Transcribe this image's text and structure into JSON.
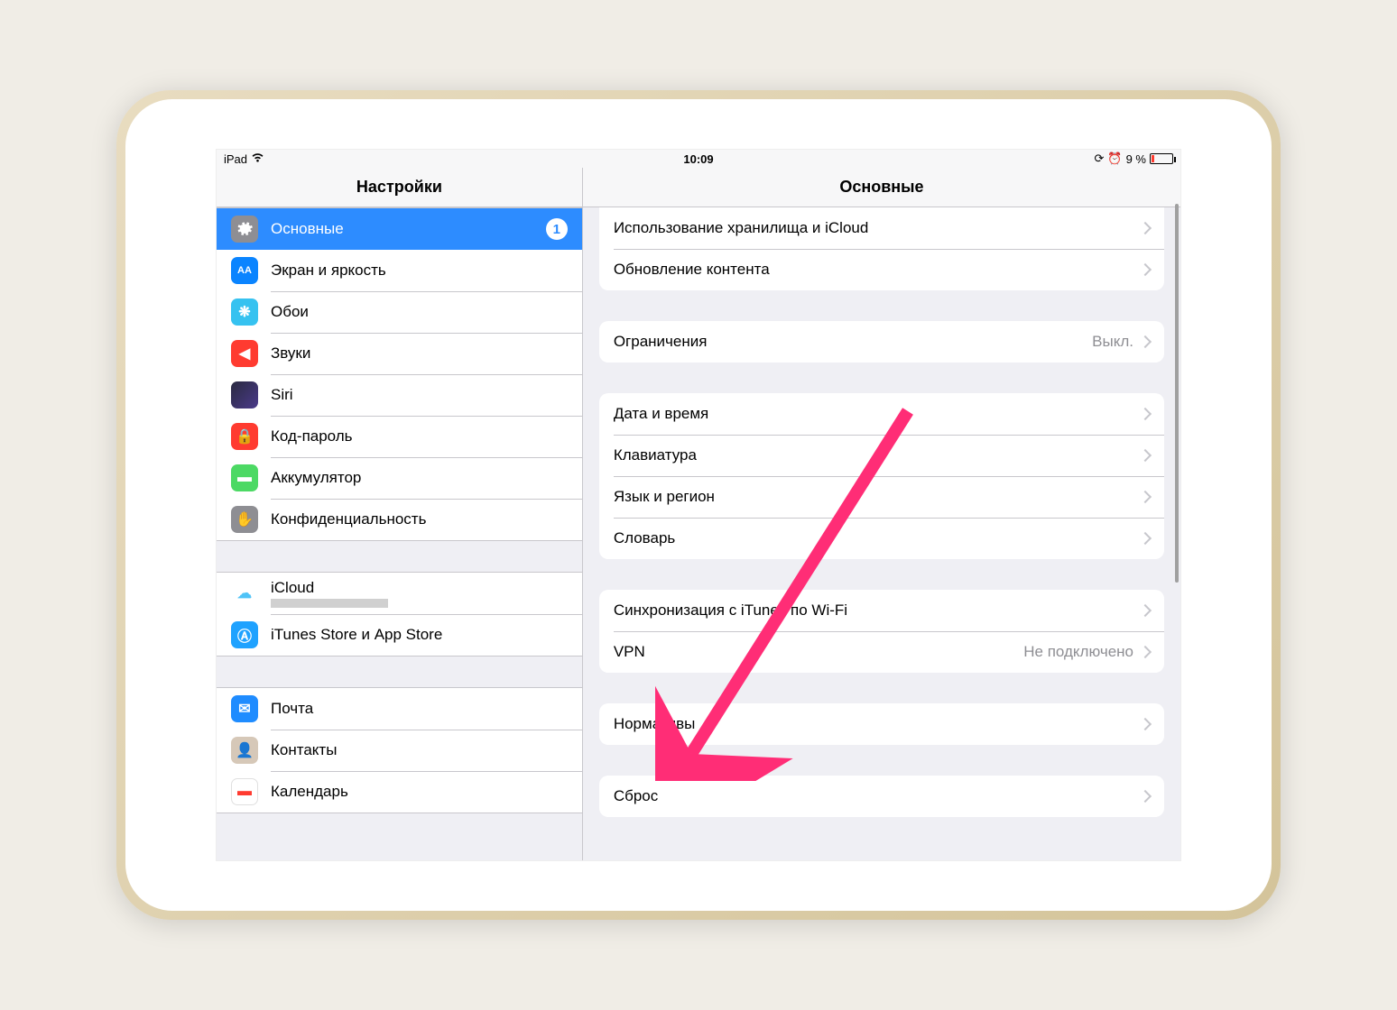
{
  "statusbar": {
    "device": "iPad",
    "time": "10:09",
    "battery_percent": "9 %"
  },
  "sidebar": {
    "title": "Настройки",
    "groups": [
      [
        {
          "id": "general",
          "label": "Основные",
          "icon": "gear-icon",
          "color": "ic-general",
          "selected": true,
          "badge": "1"
        },
        {
          "id": "display",
          "label": "Экран и яркость",
          "icon": "text-size-icon",
          "color": "ic-display",
          "glyph": "AA"
        },
        {
          "id": "wallpaper",
          "label": "Обои",
          "icon": "flower-icon",
          "color": "ic-wallpaper",
          "glyph": "❋"
        },
        {
          "id": "sounds",
          "label": "Звуки",
          "icon": "speaker-icon",
          "color": "ic-sounds",
          "glyph": "◀︎"
        },
        {
          "id": "siri",
          "label": "Siri",
          "icon": "siri-icon",
          "color": "ic-siri",
          "glyph": ""
        },
        {
          "id": "passcode",
          "label": "Код-пароль",
          "icon": "lock-icon",
          "color": "ic-passcode",
          "glyph": "🔒"
        },
        {
          "id": "battery",
          "label": "Аккумулятор",
          "icon": "battery-icon",
          "color": "ic-battery",
          "glyph": "▬"
        },
        {
          "id": "privacy",
          "label": "Конфиденциальность",
          "icon": "hand-icon",
          "color": "ic-privacy",
          "glyph": "✋"
        }
      ],
      [
        {
          "id": "icloud",
          "label": "iCloud",
          "icon": "cloud-icon",
          "color": "ic-icloud",
          "glyph": "☁︎",
          "glyph_color": "#4fc3f7",
          "has_sub": true
        },
        {
          "id": "itunes",
          "label": "iTunes Store и App Store",
          "icon": "appstore-icon",
          "color": "ic-itunes",
          "glyph": "Ⓐ"
        }
      ],
      [
        {
          "id": "mail",
          "label": "Почта",
          "icon": "mail-icon",
          "color": "ic-mail",
          "glyph": "✉︎"
        },
        {
          "id": "contacts",
          "label": "Контакты",
          "icon": "contacts-icon",
          "color": "ic-contacts",
          "glyph": "👤"
        },
        {
          "id": "calendar",
          "label": "Календарь",
          "icon": "calendar-icon",
          "color": "ic-calendar",
          "glyph": "▬",
          "glyph_color": "#ff3b30"
        }
      ]
    ]
  },
  "detail": {
    "title": "Основные",
    "groups": [
      [
        {
          "id": "storage",
          "label": "Использование хранилища и iCloud"
        },
        {
          "id": "background",
          "label": "Обновление контента"
        }
      ],
      [
        {
          "id": "restrictions",
          "label": "Ограничения",
          "value": "Выкл."
        }
      ],
      [
        {
          "id": "date",
          "label": "Дата и время"
        },
        {
          "id": "keyboard",
          "label": "Клавиатура"
        },
        {
          "id": "language",
          "label": "Язык и регион"
        },
        {
          "id": "dictionary",
          "label": "Словарь"
        }
      ],
      [
        {
          "id": "itunes_wifi",
          "label": "Синхронизация с iTunes по Wi-Fi"
        },
        {
          "id": "vpn",
          "label": "VPN",
          "value": "Не подключено"
        }
      ],
      [
        {
          "id": "regulatory",
          "label": "Нормативы"
        }
      ],
      [
        {
          "id": "reset",
          "label": "Сброс"
        }
      ]
    ]
  },
  "annotation_color": "#ff2d76"
}
